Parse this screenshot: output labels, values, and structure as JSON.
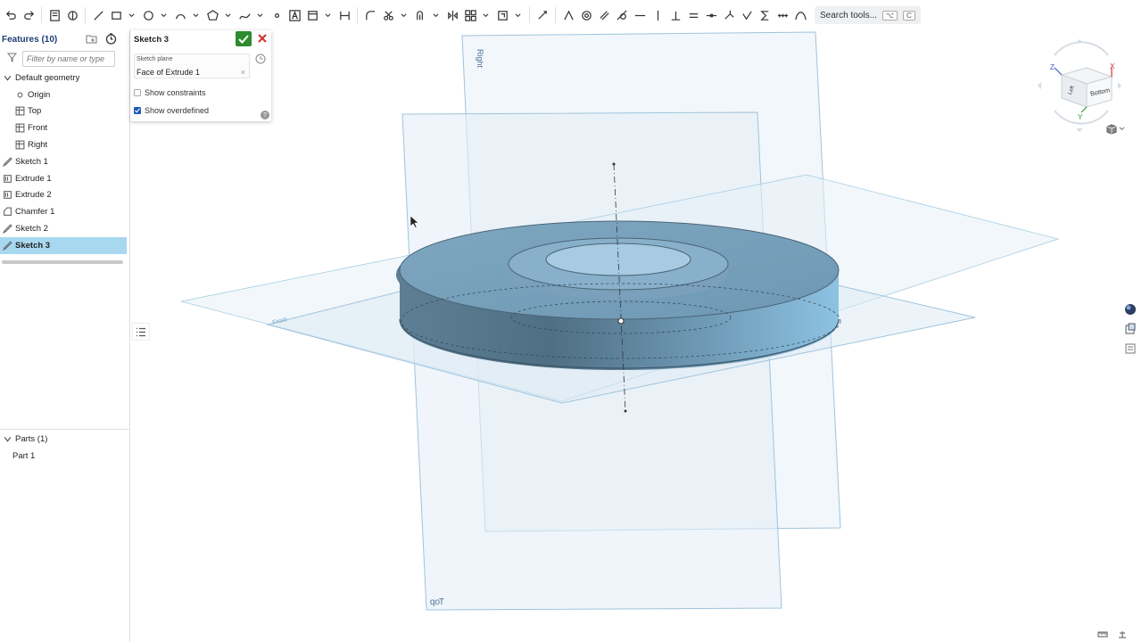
{
  "toolbar": {
    "search_label": "Search tools...",
    "search_shortcut_1": "⌥",
    "search_shortcut_2": "C"
  },
  "features": {
    "title": "Features (10)",
    "filter_placeholder": "Filter by name or type",
    "items": [
      {
        "label": "Default geometry",
        "icon": "chevron-down-icon"
      },
      {
        "label": "Origin",
        "icon": "origin-icon"
      },
      {
        "label": "Top",
        "icon": "plane-icon"
      },
      {
        "label": "Front",
        "icon": "plane-icon"
      },
      {
        "label": "Right",
        "icon": "plane-icon"
      },
      {
        "label": "Sketch 1",
        "icon": "sketch-icon"
      },
      {
        "label": "Extrude 1",
        "icon": "extrude-icon"
      },
      {
        "label": "Extrude 2",
        "icon": "extrude-icon"
      },
      {
        "label": "Chamfer 1",
        "icon": "chamfer-icon"
      },
      {
        "label": "Sketch 2",
        "icon": "sketch-icon"
      },
      {
        "label": "Sketch 3",
        "icon": "sketch-icon",
        "selected": true
      }
    ]
  },
  "parts": {
    "title": "Parts (1)",
    "items": [
      {
        "label": "Part 1"
      }
    ]
  },
  "sketch_dialog": {
    "title": "Sketch 3",
    "plane_label": "Sketch plane",
    "plane_value": "Face of Extrude 1",
    "plane_clear": "×",
    "show_constraints": "Show constraints",
    "show_constraints_checked": false,
    "show_overdefined": "Show overdefined",
    "show_overdefined_checked": true,
    "help": "?"
  },
  "viewport": {
    "plane_labels": {
      "right": "Right",
      "top": "Top",
      "front": "Front"
    }
  },
  "viewcube": {
    "face_front": "Bottom",
    "face_left": "Left",
    "axis_x": "X",
    "axis_y": "Y",
    "axis_z": "Z"
  },
  "colors": {
    "accent": "#1e5bb5",
    "selected_row": "#a8d8f0",
    "part_body": "#6f98b4",
    "plane_fill": "#e8f2f8",
    "plane_edge": "#9fc3dc"
  }
}
